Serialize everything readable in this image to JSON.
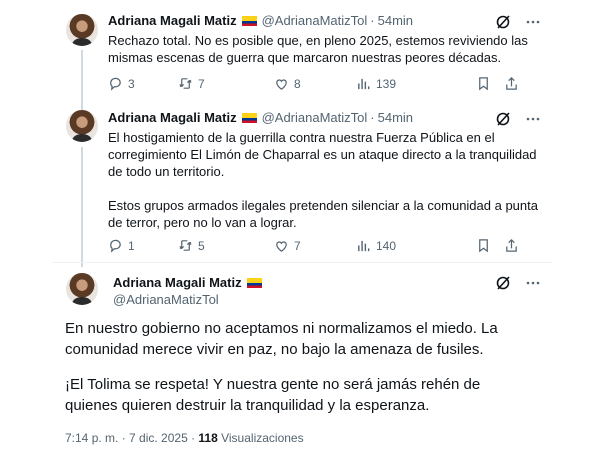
{
  "author": {
    "name": "Adriana Magali Matiz",
    "handle": "@AdrianaMatizTol",
    "flag_colors": [
      "#fcd116",
      "#003893",
      "#ce1126"
    ]
  },
  "tweets": [
    {
      "time": "54min",
      "text": "Rechazo total. No es posible que, en pleno 2025, estemos reviviendo las mismas escenas de guerra que marcaron nuestras peores décadas.",
      "replies": "3",
      "reposts": "7",
      "likes": "8",
      "views": "139"
    },
    {
      "time": "54min",
      "paragraph1": "El hostigamiento de la guerrilla contra nuestra Fuerza Pública en el corregimiento El Limón de Chaparral es un ataque directo a la tranquilidad de todo un territorio.",
      "paragraph2": "Estos grupos armados ilegales pretenden silenciar a la comunidad a punta de terror, pero no lo van a lograr.",
      "replies": "1",
      "reposts": "5",
      "likes": "7",
      "views": "140"
    }
  ],
  "main_tweet": {
    "paragraph1": "En nuestro gobierno no aceptamos ni normalizamos el miedo. La comunidad merece vivir en paz, no bajo la amenaza de fusiles.",
    "paragraph2": "¡El Tolima se respeta! Y nuestra gente no será jamás rehén de quienes quieren destruir la tranquilidad y la esperanza.",
    "timestamp": "7:14 p. m. · 7 dic. 2025 · ",
    "views_count": "118",
    "views_label": " Visualizaciones"
  },
  "icons": {
    "grok": "grok-icon",
    "more": "more-icon",
    "reply": "reply-icon",
    "repost": "repost-icon",
    "like": "like-icon",
    "views": "views-icon",
    "bookmark": "bookmark-icon",
    "share": "share-icon"
  }
}
